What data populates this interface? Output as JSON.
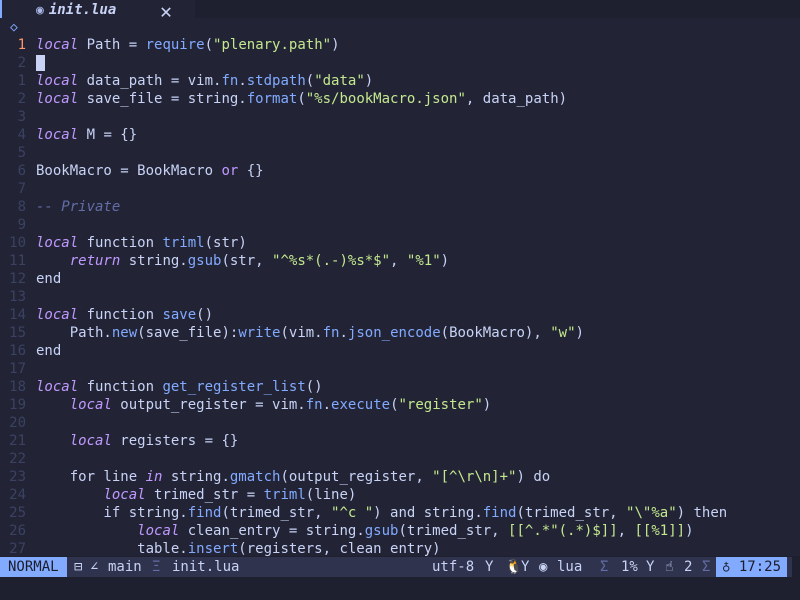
{
  "tab": {
    "icon": "lua-icon",
    "filename": "init.lua",
    "close_glyph": "✕"
  },
  "sign_glyph": "◇",
  "lines": [
    {
      "num": "1",
      "cur": true,
      "html": "<span class=\"kw\">local</span> Path = <span class=\"fn\">require</span>(<span class=\"str\">\"plenary.path\"</span>)"
    },
    {
      "num": "2",
      "cur": false,
      "cursor": true,
      "html": ""
    },
    {
      "num": "1",
      "cur": false,
      "html": "<span class=\"kw\">local</span> data_path = vim.<span class=\"fn\">fn</span>.<span class=\"fn\">stdpath</span>(<span class=\"str\">\"data\"</span>)"
    },
    {
      "num": "2",
      "cur": false,
      "html": "<span class=\"kw\">local</span> save_file = string.<span class=\"fn\">format</span>(<span class=\"str\">\"%s/bookMacro.json\"</span>, data_path)"
    },
    {
      "num": "3",
      "cur": false,
      "html": ""
    },
    {
      "num": "4",
      "cur": false,
      "html": "<span class=\"kw\">local</span> M = {}"
    },
    {
      "num": "5",
      "cur": false,
      "html": ""
    },
    {
      "num": "6",
      "cur": false,
      "html": "BookMacro = BookMacro <span class=\"kw\" style=\"font-style:normal\">or</span> {}"
    },
    {
      "num": "7",
      "cur": false,
      "html": ""
    },
    {
      "num": "8",
      "cur": false,
      "html": "<span class=\"cm\">-- Private</span>"
    },
    {
      "num": "9",
      "cur": false,
      "html": ""
    },
    {
      "num": "10",
      "cur": false,
      "html": "<span class=\"kw\">local</span> function <span class=\"fn\">triml</span>(str)"
    },
    {
      "num": "11",
      "cur": false,
      "html": "    <span class=\"kw\">return</span> string.<span class=\"fn\">gsub</span>(str, <span class=\"str\">\"^%s*(.-)%s*$\"</span>, <span class=\"str\">\"%1\"</span>)"
    },
    {
      "num": "12",
      "cur": false,
      "html": "end"
    },
    {
      "num": "13",
      "cur": false,
      "html": ""
    },
    {
      "num": "14",
      "cur": false,
      "html": "<span class=\"kw\">local</span> function <span class=\"fn\">save</span>()"
    },
    {
      "num": "15",
      "cur": false,
      "html": "    Path.<span class=\"fn\">new</span>(save_file):<span class=\"fn\">write</span>(vim.<span class=\"fn\">fn</span>.<span class=\"fn\">json_encode</span>(BookMacro), <span class=\"str\">\"w\"</span>)"
    },
    {
      "num": "16",
      "cur": false,
      "html": "end"
    },
    {
      "num": "17",
      "cur": false,
      "html": ""
    },
    {
      "num": "18",
      "cur": false,
      "html": "<span class=\"kw\">local</span> function <span class=\"fn\">get_register_list</span>()"
    },
    {
      "num": "19",
      "cur": false,
      "html": "    <span class=\"kw\">local</span> output_register = vim.<span class=\"fn\">fn</span>.<span class=\"fn\">execute</span>(<span class=\"str\">\"register\"</span>)"
    },
    {
      "num": "20",
      "cur": false,
      "html": ""
    },
    {
      "num": "21",
      "cur": false,
      "html": "    <span class=\"kw\">local</span> registers = {}"
    },
    {
      "num": "22",
      "cur": false,
      "html": ""
    },
    {
      "num": "23",
      "cur": false,
      "html": "    for line <span class=\"kw\">in</span> string.<span class=\"fn\">gmatch</span>(output_register, <span class=\"str\">\"[^\\r\\n]+\"</span>) do"
    },
    {
      "num": "24",
      "cur": false,
      "html": "        <span class=\"kw\">local</span> trimed_str = <span class=\"fn\">triml</span>(line)"
    },
    {
      "num": "25",
      "cur": false,
      "html": "        if string.<span class=\"fn\">find</span>(trimed_str, <span class=\"str\">\"^c \"</span>) and string.<span class=\"fn\">find</span>(trimed_str, <span class=\"str\">\"\\\"%a\"</span>) then"
    },
    {
      "num": "26",
      "cur": false,
      "html": "            <span class=\"kw\">local</span> clean_entry = string.<span class=\"fn\">gsub</span>(trimed_str, <span class=\"str\">[[^.*\"(.*)$]]</span>, <span class=\"str\">[[%1]]</span>)"
    },
    {
      "num": "27",
      "cur": false,
      "html": "            table.<span class=\"fn\">insert</span>(registers, clean_entry)"
    }
  ],
  "status": {
    "mode": "NORMAL",
    "git_icon": "⊟",
    "branch_icon": "∠",
    "branch": "main",
    "filename": "init.lua",
    "encoding": "utf-8",
    "enc_icon": "Y",
    "os_icon": "🐧",
    "os_suffix": "Y",
    "ft_icon": "◉",
    "filetype": "lua",
    "ft_sep": "Σ",
    "percent": "1%",
    "pct_icon": "Y",
    "clients_icon": "☝",
    "clients": "2",
    "clients_sep": "Σ",
    "clock_icon": "♁",
    "time": "17:25"
  }
}
